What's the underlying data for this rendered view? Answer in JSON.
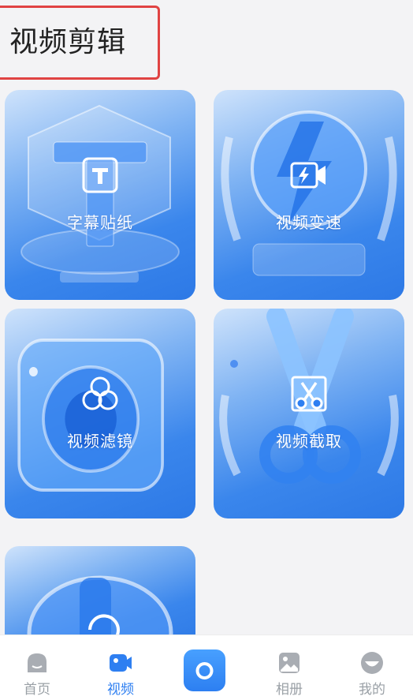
{
  "header": {
    "title": "视频剪辑"
  },
  "cards": [
    {
      "label": "字幕贴纸",
      "icon": "subtitle-t-icon"
    },
    {
      "label": "视频变速",
      "icon": "speed-camera-icon"
    },
    {
      "label": "视频滤镜",
      "icon": "filter-circles-icon"
    },
    {
      "label": "视频截取",
      "icon": "scissors-icon"
    },
    {
      "label": "",
      "icon": "rotate-icon"
    }
  ],
  "tabbar": {
    "items": [
      {
        "label": "首页",
        "icon": "home-icon",
        "active": false
      },
      {
        "label": "视频",
        "icon": "video-icon",
        "active": true
      },
      {
        "label": "",
        "icon": "camera-icon",
        "active": false
      },
      {
        "label": "相册",
        "icon": "album-icon",
        "active": false
      },
      {
        "label": "我的",
        "icon": "profile-icon",
        "active": false
      }
    ]
  },
  "colors": {
    "accent": "#2e7ff1",
    "highlight_border": "#e04343",
    "tab_inactive": "#9aa0a6"
  }
}
